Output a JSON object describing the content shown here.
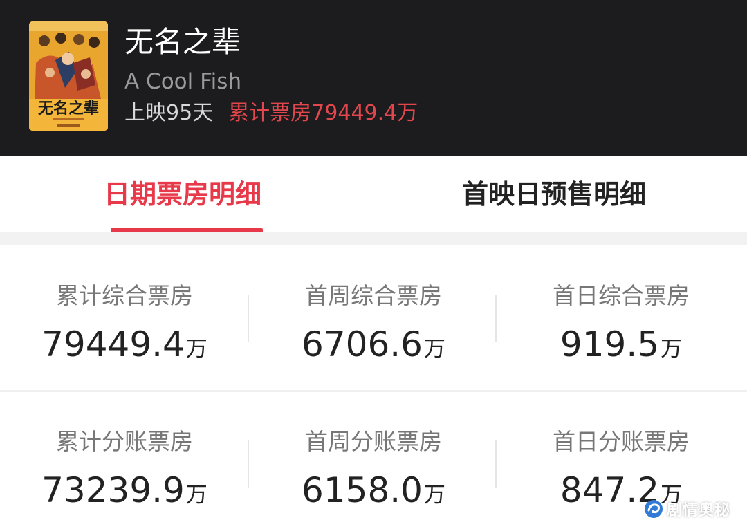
{
  "header": {
    "poster_title_art": "无名之辈",
    "title": "无名之辈",
    "english_title": "A Cool Fish",
    "days_in_release": "上映95天",
    "cumulative_box_office": "累计票房79449.4万",
    "accent_color": "#e2474d"
  },
  "tabs": [
    {
      "label": "日期票房明细",
      "active": true
    },
    {
      "label": "首映日预售明细",
      "active": false
    }
  ],
  "stats": {
    "row1": [
      {
        "label": "累计综合票房",
        "value": "79449.4",
        "unit": "万"
      },
      {
        "label": "首周综合票房",
        "value": "6706.6",
        "unit": "万"
      },
      {
        "label": "首日综合票房",
        "value": "919.5",
        "unit": "万"
      }
    ],
    "row2": [
      {
        "label": "累计分账票房",
        "value": "73239.9",
        "unit": "万"
      },
      {
        "label": "首周分账票房",
        "value": "6158.0",
        "unit": "万"
      },
      {
        "label": "首日分账票房",
        "value": "847.2",
        "unit": "万"
      }
    ]
  },
  "watermark": {
    "text": "剧情奥秘",
    "icon": "logo-swirl-icon"
  }
}
